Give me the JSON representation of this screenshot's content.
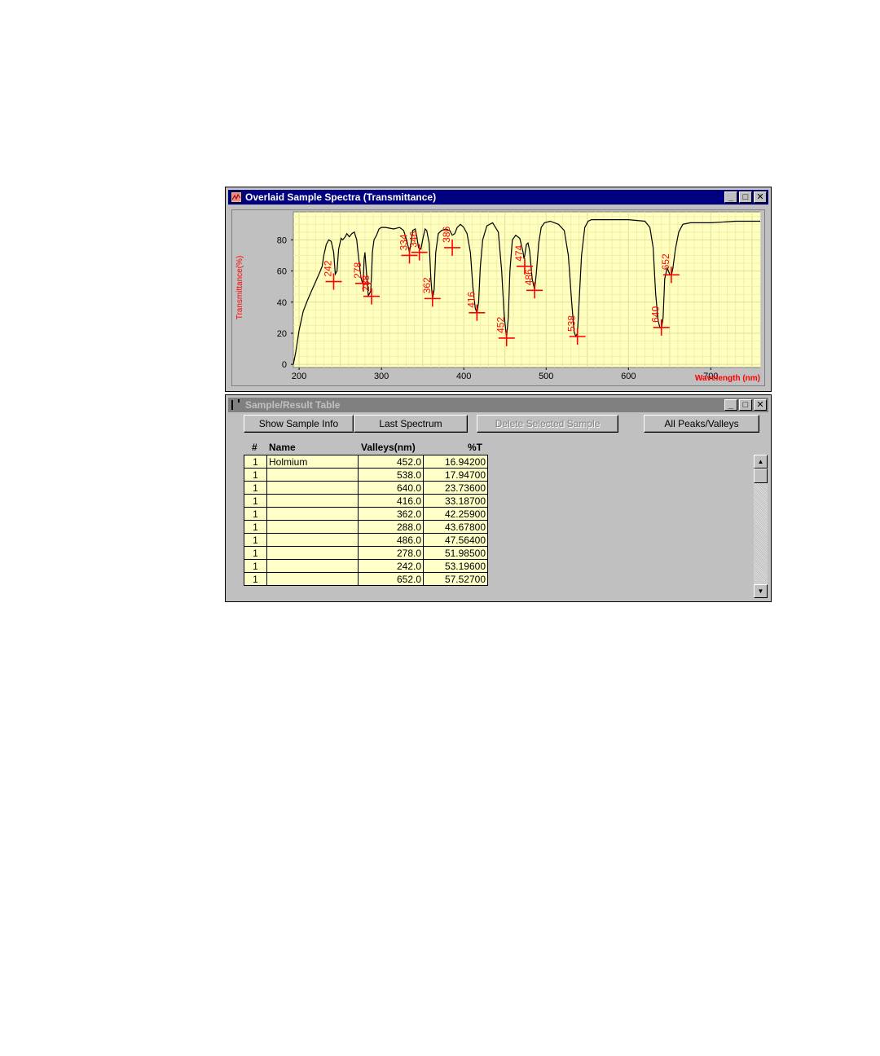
{
  "spectra_window": {
    "title": "Overlaid Sample Spectra (Transmittance)",
    "controls": {
      "minimize": "_",
      "maximize": "□",
      "close": "✕"
    }
  },
  "chart_data": {
    "type": "line",
    "ylabel": "Transmittance(%)",
    "xlabel": "Wavelength (nm)",
    "xlim": [
      193,
      760
    ],
    "ylim": [
      -2,
      98
    ],
    "x_ticks": [
      200,
      300,
      400,
      500,
      600,
      700
    ],
    "y_ticks": [
      0,
      20,
      40,
      60,
      80
    ],
    "grid": true,
    "background": "#ffffc0",
    "line_color": "#000000",
    "marker_color": "#ff0000",
    "series": [
      {
        "x": [
          193,
          196,
          200,
          205,
          210,
          215,
          220,
          225,
          228,
          230,
          233,
          236,
          239,
          242,
          244,
          246,
          248,
          251,
          253,
          256,
          258,
          261,
          264,
          267,
          270,
          272,
          275,
          277,
          278,
          279,
          280,
          282,
          284,
          287,
          288,
          289,
          291,
          294,
          297,
          300,
          305,
          315,
          322,
          327,
          331,
          334,
          336,
          338,
          341,
          343,
          345,
          348,
          350,
          353,
          355,
          358,
          360,
          362,
          364,
          366,
          369,
          373,
          378,
          383,
          386,
          389,
          392,
          396,
          400,
          404,
          408,
          411,
          414,
          416,
          418,
          420,
          423,
          428,
          435,
          442,
          446,
          449,
          452,
          454,
          456,
          459,
          463,
          468,
          472,
          473,
          474,
          476,
          478,
          480,
          483,
          486,
          488,
          491,
          494,
          498,
          505,
          515,
          522,
          527,
          531,
          534,
          536,
          538,
          540,
          543,
          547,
          551,
          555,
          562,
          575,
          600,
          620,
          626,
          630,
          633,
          636,
          638,
          640,
          642,
          644,
          647,
          650,
          652,
          654,
          657,
          661,
          666,
          675,
          700,
          730,
          760
        ],
        "y": [
          0,
          8,
          22,
          34,
          41,
          47,
          53,
          59,
          63,
          70,
          77,
          80,
          79,
          72,
          58,
          60,
          74,
          81,
          80,
          82,
          84,
          82,
          84,
          85,
          80,
          70,
          56,
          52,
          55,
          68,
          72,
          58,
          44,
          47,
          58,
          72,
          80,
          83,
          87,
          88,
          88,
          87,
          88,
          86,
          79,
          72,
          78,
          86,
          87,
          82,
          75,
          74,
          80,
          87,
          86,
          78,
          55,
          42,
          48,
          72,
          84,
          86,
          87,
          86,
          83,
          84,
          88,
          90,
          88,
          84,
          72,
          50,
          36,
          33,
          40,
          62,
          80,
          89,
          91,
          85,
          60,
          32,
          17,
          30,
          60,
          80,
          83,
          81,
          72,
          68,
          70,
          77,
          78,
          73,
          55,
          48,
          58,
          78,
          88,
          91,
          92,
          90,
          86,
          70,
          40,
          21,
          18,
          20,
          40,
          70,
          88,
          92,
          93,
          93,
          93,
          93,
          92,
          88,
          75,
          45,
          28,
          24,
          23,
          30,
          55,
          62,
          58,
          57,
          62,
          74,
          85,
          90,
          91,
          91,
          92,
          92
        ]
      }
    ],
    "markers": [
      {
        "label": "242",
        "x": 242,
        "y": 53.2
      },
      {
        "label": "278",
        "x": 278,
        "y": 52.0
      },
      {
        "label": "288",
        "x": 288,
        "y": 43.7
      },
      {
        "label": "334",
        "x": 334,
        "y": 70.0
      },
      {
        "label": "346",
        "x": 346,
        "y": 72.0
      },
      {
        "label": "362",
        "x": 362,
        "y": 42.3
      },
      {
        "label": "386",
        "x": 386,
        "y": 75.0
      },
      {
        "label": "416",
        "x": 416,
        "y": 33.2
      },
      {
        "label": "452",
        "x": 452,
        "y": 16.9
      },
      {
        "label": "474",
        "x": 474,
        "y": 63.0
      },
      {
        "label": "486",
        "x": 486,
        "y": 47.6
      },
      {
        "label": "538",
        "x": 538,
        "y": 17.9
      },
      {
        "label": "640",
        "x": 640,
        "y": 23.7
      },
      {
        "label": "652",
        "x": 652,
        "y": 57.5
      }
    ]
  },
  "table_window": {
    "title": "Sample/Result Table",
    "controls": {
      "minimize": "_",
      "maximize": "□",
      "close": "✕"
    },
    "buttons": {
      "show_sample_info": "Show Sample Info",
      "last_spectrum": "Last Spectrum",
      "delete_selected_sample": "Delete Selected Sample",
      "all_peaks_valleys": "All Peaks/Valleys"
    },
    "columns": {
      "num": "#",
      "name": "Name",
      "valleys": "Valleys(nm)",
      "t": "%T"
    },
    "rows": [
      {
        "num": "1",
        "name": "Holmium",
        "valley": "452.0",
        "t": "16.94200"
      },
      {
        "num": "1",
        "name": "",
        "valley": "538.0",
        "t": "17.94700"
      },
      {
        "num": "1",
        "name": "",
        "valley": "640.0",
        "t": "23.73600"
      },
      {
        "num": "1",
        "name": "",
        "valley": "416.0",
        "t": "33.18700"
      },
      {
        "num": "1",
        "name": "",
        "valley": "362.0",
        "t": "42.25900"
      },
      {
        "num": "1",
        "name": "",
        "valley": "288.0",
        "t": "43.67800"
      },
      {
        "num": "1",
        "name": "",
        "valley": "486.0",
        "t": "47.56400"
      },
      {
        "num": "1",
        "name": "",
        "valley": "278.0",
        "t": "51.98500"
      },
      {
        "num": "1",
        "name": "",
        "valley": "242.0",
        "t": "53.19600"
      },
      {
        "num": "1",
        "name": "",
        "valley": "652.0",
        "t": "57.52700"
      }
    ]
  }
}
